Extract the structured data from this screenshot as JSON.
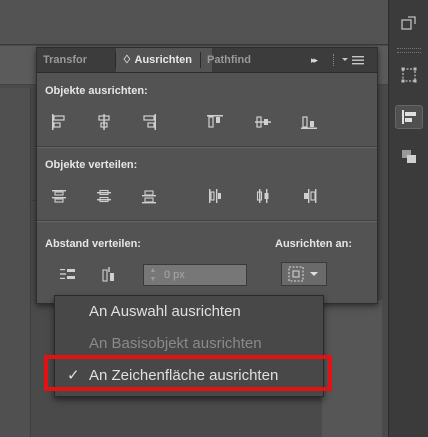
{
  "panel": {
    "tabs": [
      {
        "label": "Transfor"
      },
      {
        "label": "♢ Ausrichten"
      },
      {
        "label": "Pathfind"
      }
    ],
    "tab_menu_glyph": "▸▸",
    "objects_align": {
      "title": "Objekte ausrichten:"
    },
    "objects_distribute": {
      "title": "Objekte verteilen:"
    },
    "spacing": {
      "title": "Abstand verteilen:",
      "value": "0 px"
    },
    "align_to": {
      "title": "Ausrichten an:"
    }
  },
  "menu": {
    "items": [
      {
        "label": "An Auswahl ausrichten",
        "enabled": true,
        "checked": false
      },
      {
        "label": "An Basisobjekt ausrichten",
        "enabled": false,
        "checked": false
      },
      {
        "label": "An Zeichenfläche ausrichten",
        "enabled": true,
        "checked": true
      }
    ],
    "check_glyph": "✓"
  },
  "colors": {
    "highlight": "#e31212",
    "panel_bg": "#535353",
    "tab_bar": "#3c3c3c",
    "menu_bg": "#484848"
  }
}
